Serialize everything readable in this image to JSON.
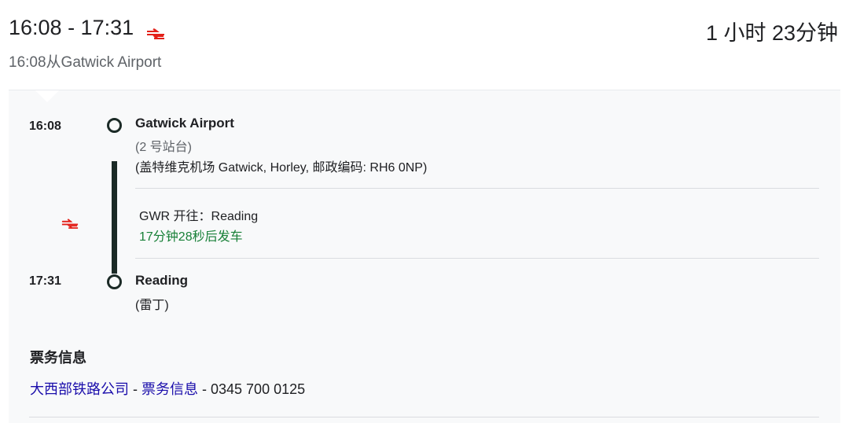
{
  "header": {
    "time_range": "16:08 - 17:31",
    "duration": "1 小时 23分钟",
    "depart_from": "16:08从Gatwick Airport",
    "rail_logo_icon": "national-rail-icon",
    "rail_logo_color": "#e32019"
  },
  "journey": {
    "origin": {
      "time": "16:08",
      "name": "Gatwick Airport",
      "platform": "(2 号站台)",
      "address": "(盖特维克机场 Gatwick, Horley, 邮政编码: RH6 0NP)"
    },
    "service": {
      "operator_line": "GWR 开往：Reading",
      "countdown": "17分钟28秒后发车",
      "countdown_color": "#188038"
    },
    "destination": {
      "time": "17:31",
      "name": "Reading",
      "local_name": "(雷丁)"
    },
    "route_color": "#1b2a26"
  },
  "tickets": {
    "heading": "票务信息",
    "company_link": "大西部铁路公司",
    "separator1": " - ",
    "ticket_link": "票务信息",
    "separator2": " - ",
    "phone": "0345 700 0125",
    "link_color": "#1a0dab"
  }
}
